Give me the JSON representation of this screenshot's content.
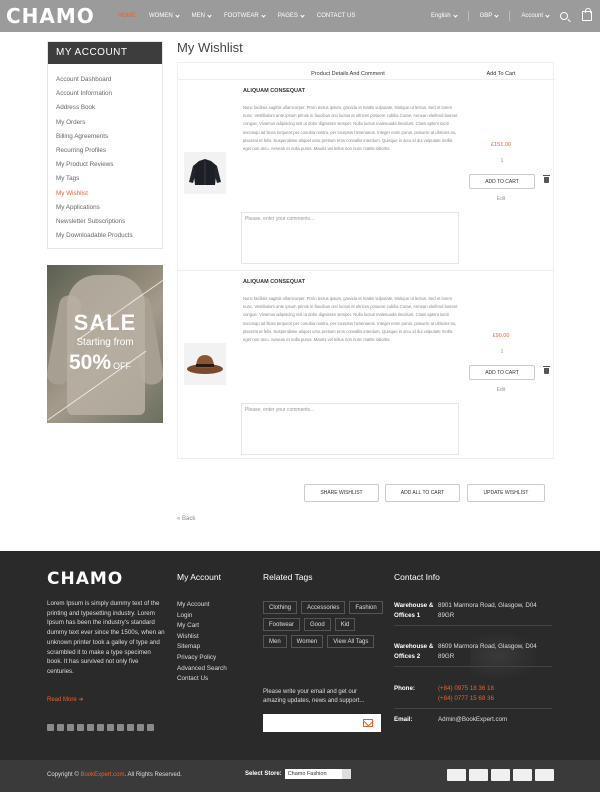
{
  "header": {
    "logo": "CHAMO",
    "nav": [
      {
        "label": "HOME",
        "active": true,
        "dropdown": false
      },
      {
        "label": "WOMEN",
        "active": false,
        "dropdown": true
      },
      {
        "label": "MEN",
        "active": false,
        "dropdown": true
      },
      {
        "label": "FOOTWEAR",
        "active": false,
        "dropdown": true
      },
      {
        "label": "PAGES",
        "active": false,
        "dropdown": true
      },
      {
        "label": "CONTACT US",
        "active": false,
        "dropdown": false
      }
    ],
    "language": "English",
    "currency": "GBP",
    "account": "Account",
    "accent_color": "#e8622e"
  },
  "sidebar": {
    "title": "MY ACCOUNT",
    "items": [
      "Account Dashboard",
      "Account Information",
      "Address Book",
      "My Orders",
      "Billing Agreements",
      "Recurring Profiles",
      "My Product Reviews",
      "My Tags",
      "My Wishlist",
      "My Applications",
      "Newsletter Subscriptions",
      "My Downloadable Products"
    ],
    "active_index": 8,
    "promo": {
      "line1": "SALE",
      "line2": "Starting from",
      "percent": "50%",
      "off": "OFF"
    }
  },
  "main": {
    "title": "My Wishlist",
    "col_details": "Product Details And Comment",
    "col_cart": "Add To Cart",
    "items": [
      {
        "name": "ALIQUAM CONSEQUAT",
        "description": "Nunc facilisis sagittis ullamcorper. Proin lectus ipsum, gravida et mattis vulputate, tristique ut lectus. Sed et lorem nunc. Vestibulum ante ipsum primis in faucibus orci luctus et ultrices posuere cubilia Curae; Aenean eleifend laoreet congue. Vivamus adipiscing nisl ut dolor dignissim semper. Nulla luctus malesuada tincidunt. Class aptent taciti sociosqu ad litora torquent per conubia nostra, per inceptos himenaeos. Integer enim purus, posuere at ultricies eu, placerat et felis. Suspendisse aliquet urna pretium eros convallis interdum. Quisque in arcu id dui vulputate mollis eget non arcu. Aenean et nulla purus. Mauris vel tellus non nunc mattis lobortis.",
        "comment_placeholder": "Please, enter your comments...",
        "price": "£151.00",
        "qty": "1",
        "add_to_cart": "ADD TO CART",
        "edit": "Edit",
        "icon": "jacket-image"
      },
      {
        "name": "ALIQUAM CONSEQUAT",
        "description": "Nunc facilisis sagittis ullamcorper. Proin lectus ipsum, gravida et mattis vulputate, tristique ut lectus. Sed et lorem nunc. Vestibulum ante ipsum primis in faucibus orci luctus et ultrices posuere cubilia Curae; Aenean eleifend laoreet congue. Vivamus adipiscing nisl ut dolor dignissim semper. Nulla luctus malesuada tincidunt. Class aptent taciti sociosqu ad litora torquent per conubia nostra, per inceptos himenaeos. Integer enim purus, posuere at ultricies eu, placerat et felis. Suspendisse aliquet urna pretium eros convallis interdum. Quisque in arcu id dui vulputate mollis eget non arcu. Aenean et nulla purus. Mauris vel tellus non nunc mattis lobortis.",
        "comment_placeholder": "Please, enter your comments...",
        "price": "£90.00",
        "qty": "1",
        "add_to_cart": "ADD TO CART",
        "edit": "Edit",
        "icon": "hat-image"
      }
    ],
    "buttons": {
      "share": "SHARE WISHLIST",
      "add_all": "ADD ALL TO CART",
      "update": "UPDATE WISHLIST"
    },
    "back": "« Back"
  },
  "footer": {
    "logo": "CHAMO",
    "about": "Lorem Ipsum is simply dummy text of the printing and typesetting industry. Lorem Ipsum has been the industry's standard dummy text ever since the 1500s, when an unknown printer took a galley of type and scrambled it to make a type specimen book. It has survived not only five centuries.",
    "read_more": "Read More",
    "my_account_title": "My Account",
    "my_account_links": [
      "My Account",
      "Login",
      "My Cart",
      "Wishlist",
      "Sitemap",
      "Privacy Policy",
      "Advanced Search",
      "Contact Us"
    ],
    "tags_title": "Related Tags",
    "tags": [
      "Clothing",
      "Accessories",
      "Fashion",
      "Footwear",
      "Good",
      "Kid",
      "Men",
      "Women",
      "View All Tags"
    ],
    "newsletter": "Please write your email and get our amazing updates, news and support...",
    "contact_title": "Contact Info",
    "contacts": [
      {
        "label": "Warehouse & Offices 1",
        "value": "8901 Marmora Road, Glasgow, D04 89GR"
      },
      {
        "label": "Warehouse & Offices 2",
        "value": "8609 Marmora Road, Glasgow, D04 89GR"
      },
      {
        "label": "Phone:",
        "value": "(+84) 0975 18 36 18\n(+84) 0777 15 68 36"
      },
      {
        "label": "Email:",
        "value": "Admin@BookExpert.com"
      }
    ]
  },
  "bottom": {
    "copyright_pre": "Copyright ©",
    "brand": "BookExpert.com",
    "copyright_post": ". All Rights Reserved.",
    "store_label": "Select Store:",
    "store_value": "Chamo Fashion",
    "payments": [
      "visa",
      "mastercard",
      "visa-electron",
      "maestro",
      "paypal"
    ]
  }
}
